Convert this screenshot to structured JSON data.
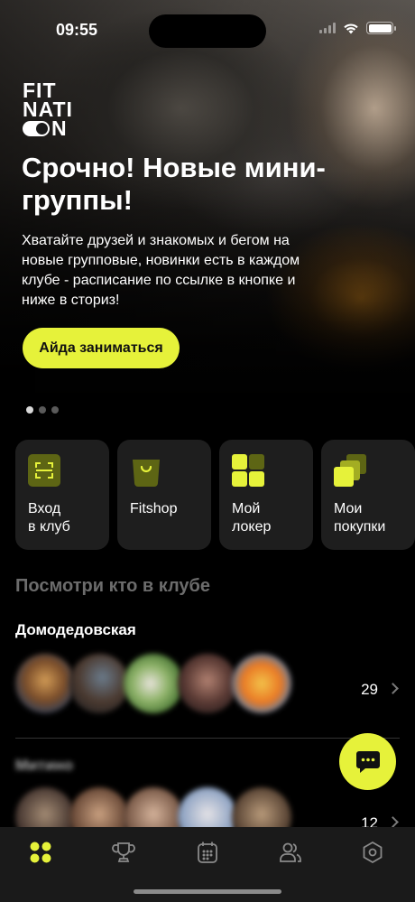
{
  "status_bar": {
    "time": "09:55"
  },
  "brand": {
    "line1": "FIT",
    "line2": "NATI",
    "line3": "N",
    "accent": "#e6f23a"
  },
  "hero": {
    "title": "Срочно! Новые мини-группы!",
    "text": "Хватайте друзей и знакомых и бегом на новые групповые, новинки есть в каждом клубе - расписание по ссылке в кнопке и ниже в сториз!",
    "cta_label": "Айда заниматься",
    "page_count": 3,
    "active_page": 1
  },
  "tiles": [
    {
      "label": "Вход\nв клуб",
      "icon": "scan-icon"
    },
    {
      "label": "Fitshop",
      "icon": "shopping-bag-icon"
    },
    {
      "label": "Мой\nлокер",
      "icon": "locker-grid-icon"
    },
    {
      "label": "Мои\nпокупки",
      "icon": "purchases-icon"
    }
  ],
  "who_in_club": {
    "title": "Посмотри кто в клубе",
    "clubs": [
      {
        "name": "Домодедовская",
        "count": "29"
      },
      {
        "name": "Митино",
        "count": "12"
      }
    ]
  },
  "tabbar": {
    "items": [
      {
        "name": "home",
        "icon": "grid-dots-icon",
        "active": true
      },
      {
        "name": "achievements",
        "icon": "trophy-icon",
        "active": false
      },
      {
        "name": "schedule",
        "icon": "calendar-icon",
        "active": false
      },
      {
        "name": "community",
        "icon": "users-icon",
        "active": false
      },
      {
        "name": "settings",
        "icon": "hexagon-icon",
        "active": false
      }
    ]
  }
}
